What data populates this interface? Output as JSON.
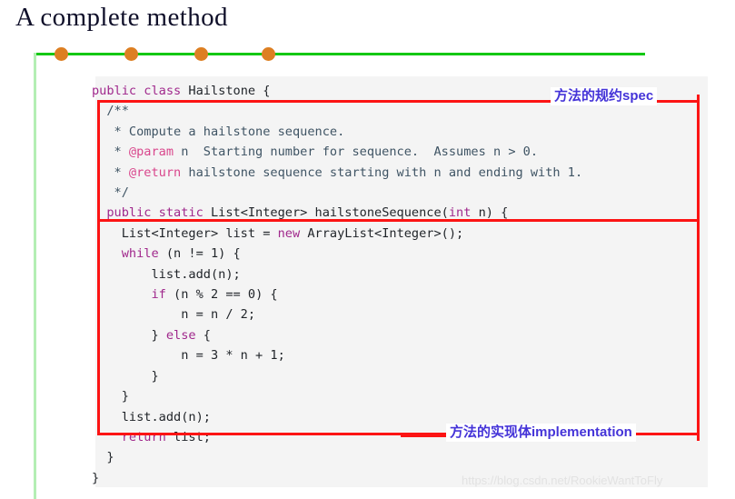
{
  "slide": {
    "title": "A complete method",
    "decor": {
      "line_color": "#14c814",
      "vertical_line_color": "#b4eeb4",
      "dot_color": "#dd7f22",
      "dot_count": 4,
      "dot_positions": [
        60,
        137,
        214,
        288
      ]
    }
  },
  "code": {
    "language": "java",
    "background": "#f4f4f4",
    "keyword_color": "#a0288c",
    "comment_color": "#3f5464",
    "javadoc_tag_color": "#d9468c",
    "lines": [
      [
        {
          "t": "public class ",
          "c": "kw"
        },
        {
          "t": "Hailstone {",
          "c": "plain"
        }
      ],
      [
        {
          "t": "  /**",
          "c": "cmt"
        }
      ],
      [
        {
          "t": "   * Compute a hailstone sequence.",
          "c": "cmt"
        }
      ],
      [
        {
          "t": "   * ",
          "c": "cmt"
        },
        {
          "t": "@param",
          "c": "tag"
        },
        {
          "t": " n  Starting number for sequence.  Assumes n > 0.",
          "c": "cmt"
        }
      ],
      [
        {
          "t": "   * ",
          "c": "cmt"
        },
        {
          "t": "@return",
          "c": "tag"
        },
        {
          "t": " hailstone sequence starting with n and ending with 1.",
          "c": "cmt"
        }
      ],
      [
        {
          "t": "   */",
          "c": "cmt"
        }
      ],
      [
        {
          "t": "  public static ",
          "c": "kw"
        },
        {
          "t": "List<Integer> hailstoneSequence(",
          "c": "plain"
        },
        {
          "t": "int",
          "c": "kw"
        },
        {
          "t": " n) {",
          "c": "plain"
        }
      ],
      [
        {
          "t": "    List<Integer> list = ",
          "c": "plain"
        },
        {
          "t": "new",
          "c": "kw"
        },
        {
          "t": " ArrayList<Integer>();",
          "c": "plain"
        }
      ],
      [
        {
          "t": "    ",
          "c": "plain"
        },
        {
          "t": "while",
          "c": "kw"
        },
        {
          "t": " (n != 1) {",
          "c": "plain"
        }
      ],
      [
        {
          "t": "        list.add(n);",
          "c": "plain"
        }
      ],
      [
        {
          "t": "        ",
          "c": "plain"
        },
        {
          "t": "if",
          "c": "kw"
        },
        {
          "t": " (n % 2 == 0) {",
          "c": "plain"
        }
      ],
      [
        {
          "t": "            n = n / 2;",
          "c": "plain"
        }
      ],
      [
        {
          "t": "        } ",
          "c": "plain"
        },
        {
          "t": "else",
          "c": "kw"
        },
        {
          "t": " {",
          "c": "plain"
        }
      ],
      [
        {
          "t": "            n = 3 * n + 1;",
          "c": "plain"
        }
      ],
      [
        {
          "t": "        }",
          "c": "plain"
        }
      ],
      [
        {
          "t": "    }",
          "c": "plain"
        }
      ],
      [
        {
          "t": "    list.add(n);",
          "c": "plain"
        }
      ],
      [
        {
          "t": "    ",
          "c": "plain"
        },
        {
          "t": "return",
          "c": "kw"
        },
        {
          "t": " list;",
          "c": "plain"
        }
      ],
      [
        {
          "t": "  }",
          "c": "plain"
        }
      ],
      [
        {
          "t": "}",
          "c": "plain"
        }
      ]
    ]
  },
  "annotations": {
    "box_color": "#fc1414",
    "label_color": "#4433d8",
    "spec": "方法的规约spec",
    "implementation": "方法的实现体implementation"
  },
  "watermark": {
    "text": "https://blog.csdn.net/RookieWantToFly"
  }
}
